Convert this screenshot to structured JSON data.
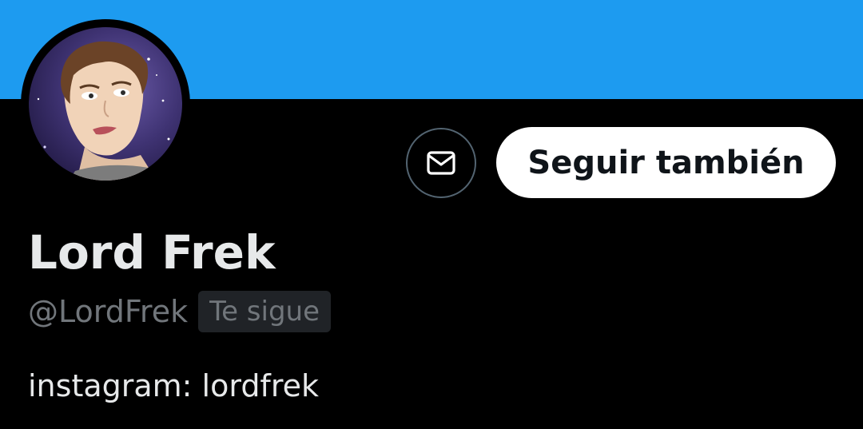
{
  "profile": {
    "display_name": "Lord Frek",
    "handle": "@LordFrek",
    "follows_you_badge": "Te sigue",
    "bio": "instagram: lordfrek"
  },
  "actions": {
    "message_icon": "envelope-icon",
    "follow_label": "Seguir también"
  },
  "colors": {
    "banner": "#1d9bf0",
    "background": "#000000",
    "primary_text": "#e7e9ea",
    "secondary_text": "#71767b",
    "badge_background": "#202327",
    "follow_button_background": "#ffffff",
    "follow_button_text": "#0f1419"
  }
}
